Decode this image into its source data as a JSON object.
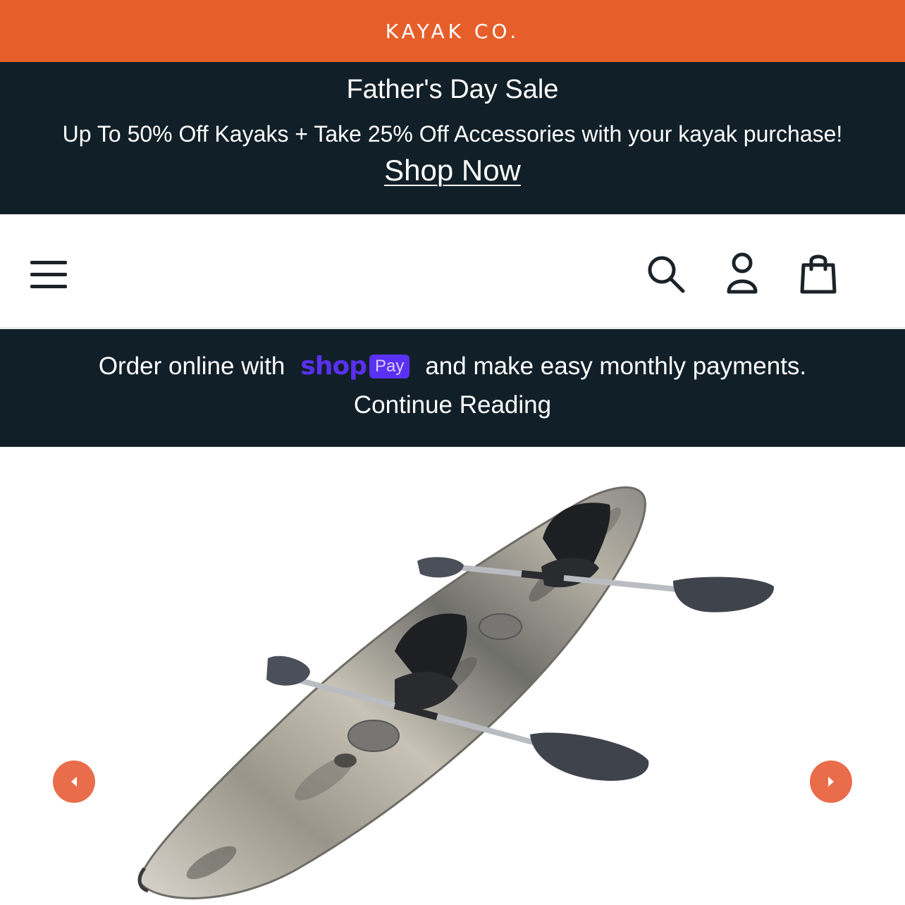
{
  "brand": {
    "name": "KAYAK CO."
  },
  "promo": {
    "title": "Father's Day Sale",
    "subtitle": "Up To 50% Off Kayaks + Take 25% Off Accessories with your kayak purchase!",
    "link_label": "Shop Now"
  },
  "header": {
    "icons": [
      "menu-icon",
      "search-icon",
      "account-icon",
      "cart-icon"
    ]
  },
  "shop_pay": {
    "prefix": "Order online with",
    "logo_word": "shop",
    "logo_badge": "Pay",
    "suffix": "and make easy monthly payments.",
    "continue_label": "Continue Reading"
  },
  "product": {
    "image": "tandem-camo-kayak-with-two-seats-and-two-paddles",
    "nav_icons": [
      "arrow-left-icon",
      "arrow-right-icon"
    ]
  },
  "colors": {
    "brand_orange": "#e65f2b",
    "navy": "#111f28",
    "shop_purple": "#5a31f4",
    "arrow_orange": "#e96d4b"
  }
}
